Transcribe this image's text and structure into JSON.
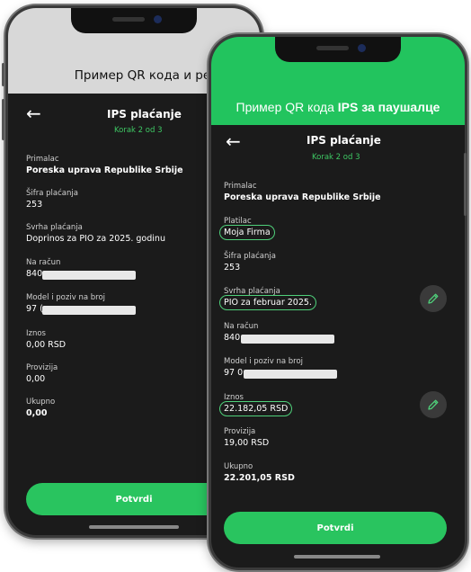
{
  "back_phone": {
    "banner_text": "Пример QR кода и решења",
    "screen": {
      "title": "IPS plaćanje",
      "step": "Korak 2 od 3",
      "fields": [
        {
          "label": "Primalac",
          "value": "Poreska uprava Republike Srbije"
        },
        {
          "label": "Šifra plaćanja",
          "value": "253"
        },
        {
          "label": "Svrha plaćanja",
          "value": "Doprinos za PIO za 2025. godinu"
        },
        {
          "label": "Na račun",
          "value": "840"
        },
        {
          "label": "Model i poziv na broj",
          "value": "97 ("
        },
        {
          "label": "Iznos",
          "value": "0,00 RSD"
        },
        {
          "label": "Provizija",
          "value": "0,00"
        },
        {
          "label": "Ukupno",
          "value": "0,00"
        }
      ],
      "confirm_label": "Potvrdi"
    }
  },
  "front_phone": {
    "banner_text_prefix": "Пример QR кода ",
    "banner_text_bold": "IPS за паушалце",
    "screen": {
      "title": "IPS plaćanje",
      "step": "Korak 2 od 3",
      "fields": [
        {
          "label": "Primalac",
          "value": "Poreska uprava Republike Srbije"
        },
        {
          "label": "Platilac",
          "value": "Moja Firma"
        },
        {
          "label": "Šifra plaćanja",
          "value": "253"
        },
        {
          "label": "Svrha plaćanja",
          "value": "PIO za februar 2025."
        },
        {
          "label": "Na račun",
          "value": "840"
        },
        {
          "label": "Model i poziv na broj",
          "value": "97 0"
        },
        {
          "label": "Iznos",
          "value": "22.182,05 RSD"
        },
        {
          "label": "Provizija",
          "value": "19,00 RSD"
        },
        {
          "label": "Ukupno",
          "value": "22.201,05 RSD"
        }
      ],
      "confirm_label": "Potvrdi"
    }
  },
  "colors": {
    "accent_green": "#22c45e",
    "step_green": "#3ec864",
    "screen_bg": "#1b1b1b"
  }
}
